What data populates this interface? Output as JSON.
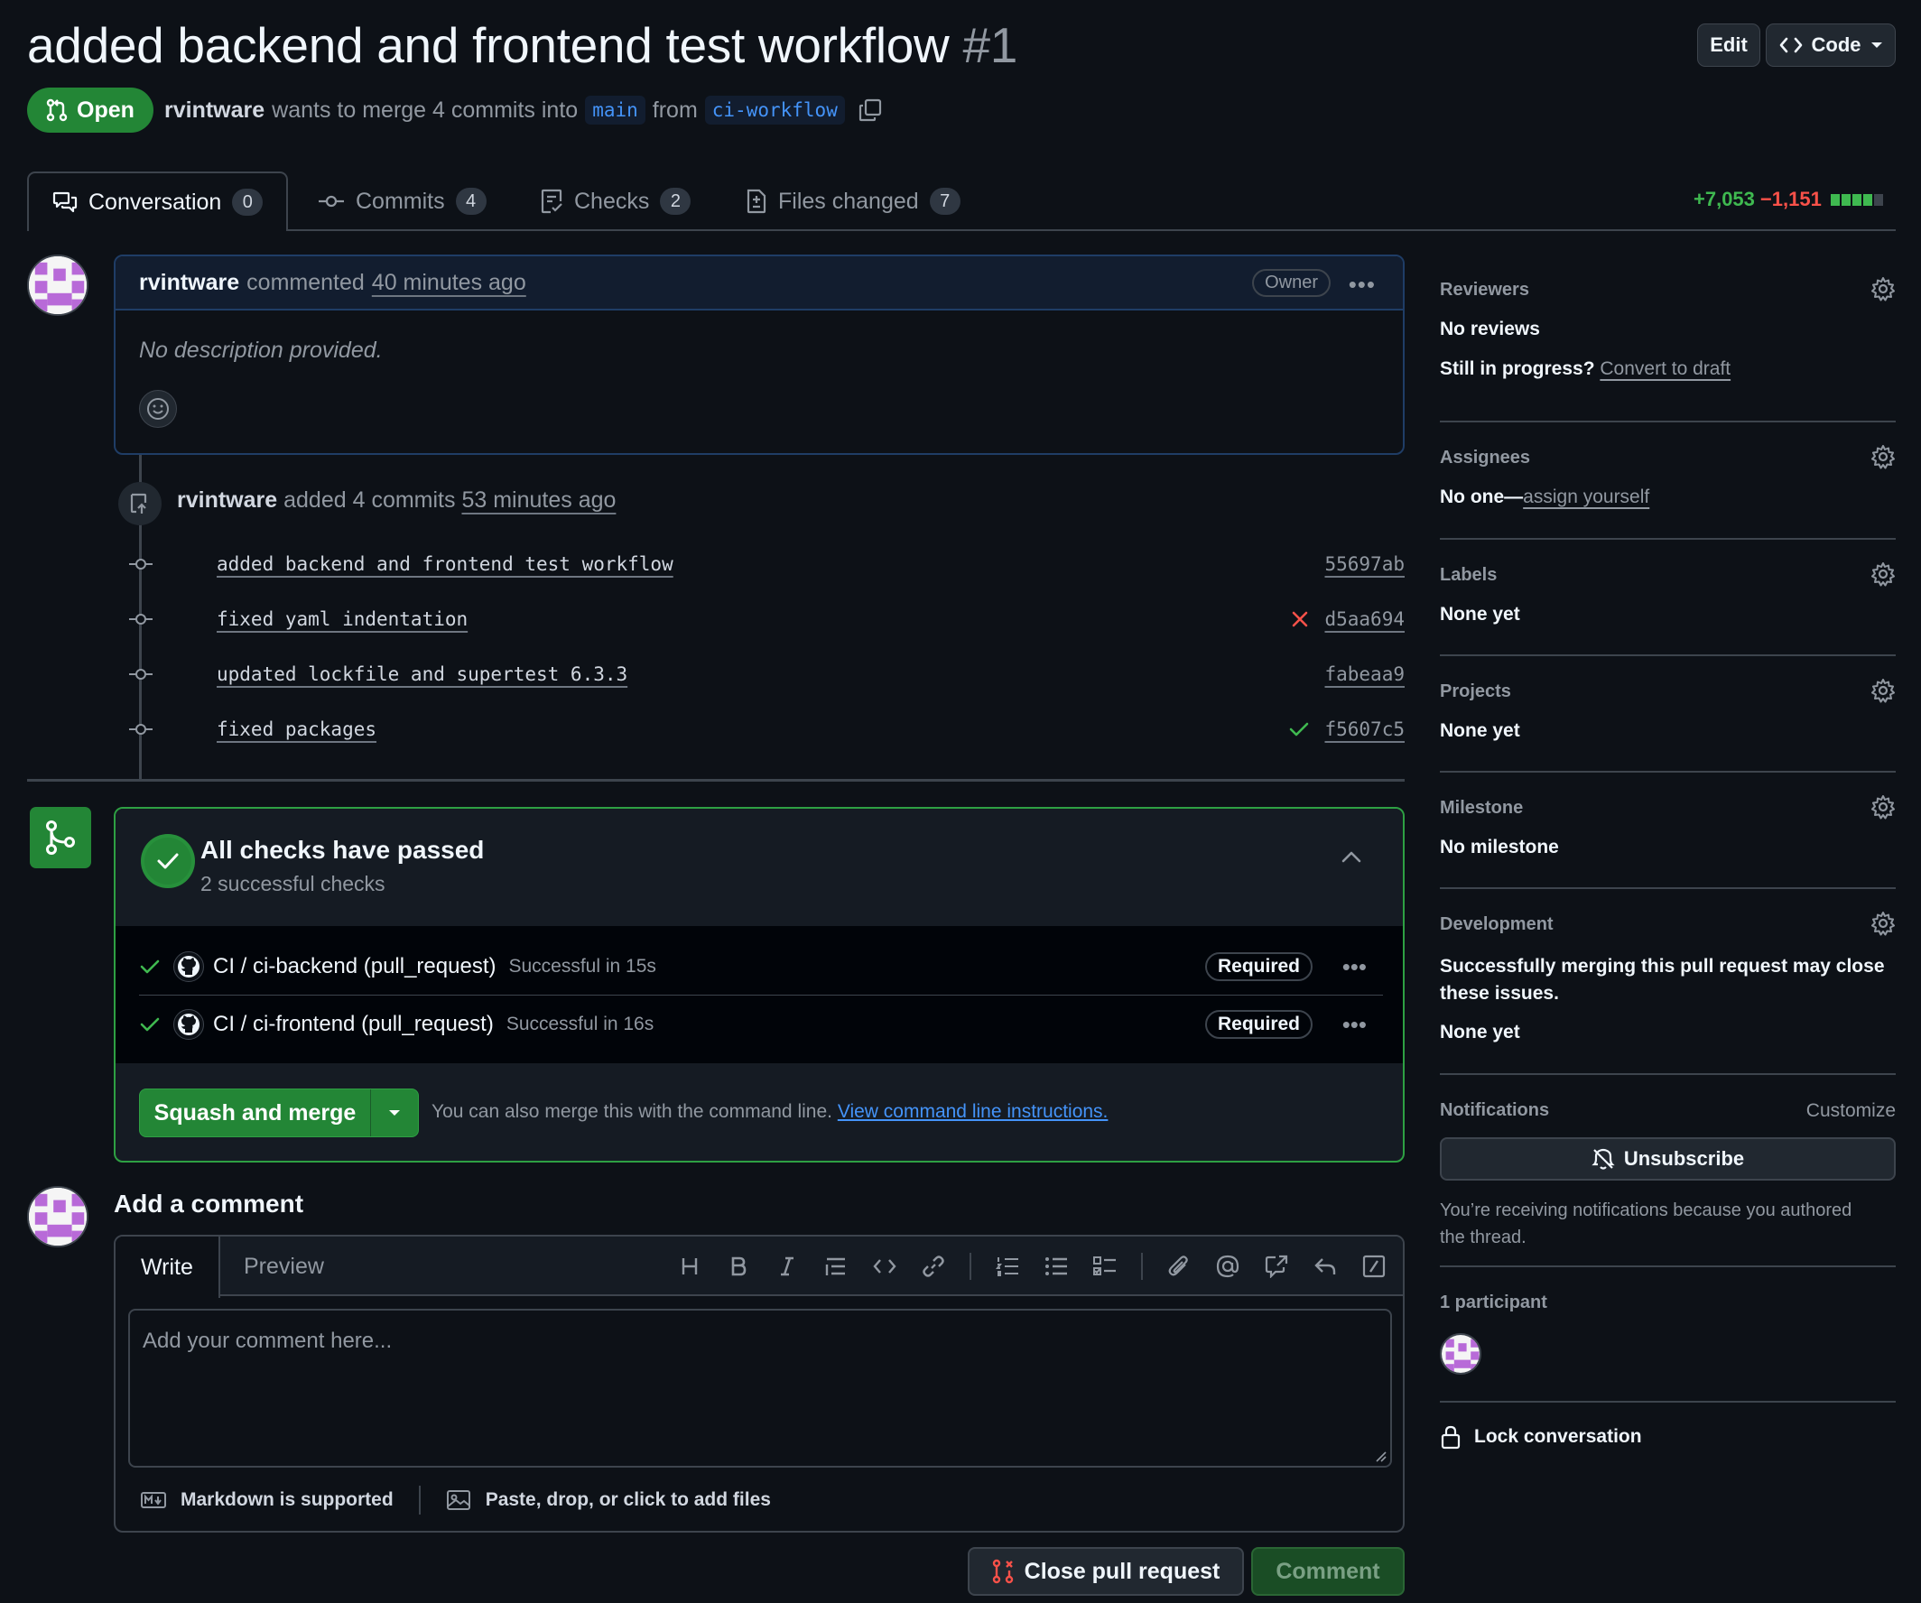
{
  "header": {
    "title": "added backend and frontend test workflow",
    "number": "#1",
    "edit_label": "Edit",
    "code_label": "Code",
    "status": "Open",
    "author": "rvintware",
    "merge_text": "wants to merge 4 commits into",
    "base_branch": "main",
    "from_text": "from",
    "head_branch": "ci-workflow"
  },
  "tabs": [
    {
      "label": "Conversation",
      "count": "0"
    },
    {
      "label": "Commits",
      "count": "4"
    },
    {
      "label": "Checks",
      "count": "2"
    },
    {
      "label": "Files changed",
      "count": "7"
    }
  ],
  "diffstat": {
    "additions": "+7,053",
    "deletions": "−1,151"
  },
  "comment": {
    "author": "rvintware",
    "action": "commented",
    "time": "40 minutes ago",
    "badge": "Owner",
    "body": "No description provided."
  },
  "push_event": {
    "author": "rvintware",
    "action": "added 4 commits",
    "time": "53 minutes ago"
  },
  "commits": [
    {
      "message": "added backend and frontend test workflow",
      "sha": "55697ab",
      "status": "none"
    },
    {
      "message": "fixed yaml indentation",
      "sha": "d5aa694",
      "status": "fail"
    },
    {
      "message": "updated lockfile and supertest 6.3.3",
      "sha": "fabeaa9",
      "status": "none"
    },
    {
      "message": "fixed packages",
      "sha": "f5607c5",
      "status": "pass"
    }
  ],
  "checks": {
    "title": "All checks have passed",
    "subtitle": "2 successful checks",
    "items": [
      {
        "name": "CI / ci-backend (pull_request)",
        "duration": "Successful in 15s",
        "badge": "Required"
      },
      {
        "name": "CI / ci-frontend (pull_request)",
        "duration": "Successful in 16s",
        "badge": "Required"
      }
    ],
    "merge_label": "Squash and merge",
    "cli_text": "You can also merge this with the command line.",
    "cli_link": "View command line instructions."
  },
  "add_comment": {
    "title": "Add a comment",
    "write_tab": "Write",
    "preview_tab": "Preview",
    "placeholder": "Add your comment here...",
    "markdown_note": "Markdown is supported",
    "files_note": "Paste, drop, or click to add files",
    "close_label": "Close pull request",
    "comment_label": "Comment"
  },
  "sidebar": {
    "reviewers": {
      "heading": "Reviewers",
      "value": "No reviews",
      "progress_q": "Still in progress?",
      "convert": "Convert to draft"
    },
    "assignees": {
      "heading": "Assignees",
      "value": "No one—",
      "assign": "assign yourself"
    },
    "labels": {
      "heading": "Labels",
      "value": "None yet"
    },
    "projects": {
      "heading": "Projects",
      "value": "None yet"
    },
    "milestone": {
      "heading": "Milestone",
      "value": "No milestone"
    },
    "development": {
      "heading": "Development",
      "note": "Successfully merging this pull request may close these issues.",
      "value": "None yet"
    },
    "notifications": {
      "heading": "Notifications",
      "customize": "Customize",
      "button": "Unsubscribe",
      "reason": "You’re receiving notifications because you authored the thread."
    },
    "participants": {
      "heading": "1 participant"
    },
    "lock": "Lock conversation"
  },
  "colors": {
    "success": "#238636",
    "danger": "#f85149",
    "accent": "#4493f8",
    "avatar": "#b86ad8"
  }
}
